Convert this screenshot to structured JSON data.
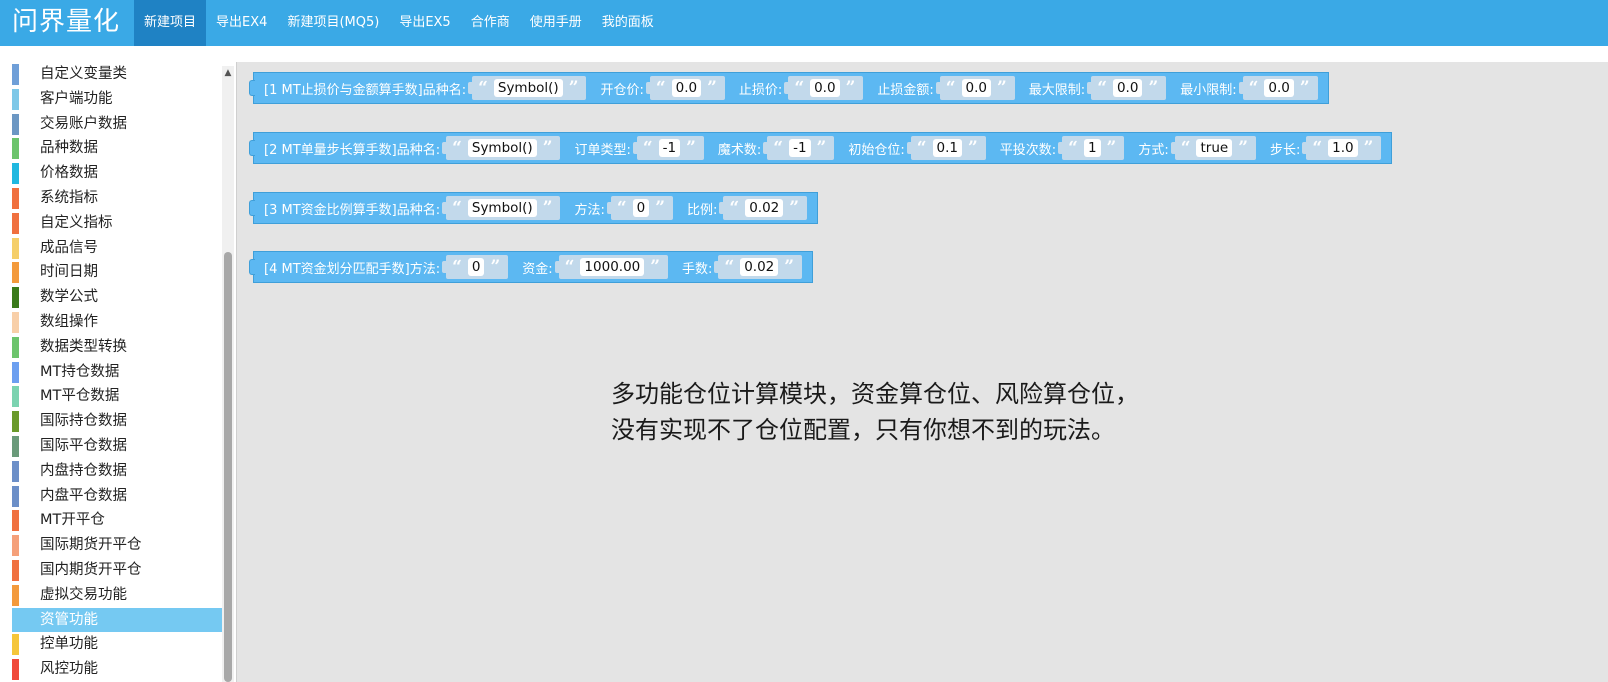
{
  "header": {
    "logo": "问界量化",
    "nav": [
      "新建项目",
      "导出EX4",
      "新建项目(MQ5)",
      "导出EX5",
      "合作商",
      "使用手册",
      "我的面板"
    ],
    "active_nav": "新建项目",
    "accent": "#3aa9e6",
    "active_bg": "#1f82c4"
  },
  "sidebar": {
    "items": [
      {
        "label": "自定义变量类",
        "color": "#6f9fd8"
      },
      {
        "label": "客户端功能",
        "color": "#7ec8e8"
      },
      {
        "label": "交易账户数据",
        "color": "#6c97c3"
      },
      {
        "label": "品种数据",
        "color": "#6cc46c"
      },
      {
        "label": "价格数据",
        "color": "#20b8e0"
      },
      {
        "label": "系统指标",
        "color": "#f0703f"
      },
      {
        "label": "自定义指标",
        "color": "#f0703f"
      },
      {
        "label": "成品信号",
        "color": "#f5cf6a"
      },
      {
        "label": "时间日期",
        "color": "#f39a3c"
      },
      {
        "label": "数学公式",
        "color": "#3a7a1a"
      },
      {
        "label": "数组操作",
        "color": "#f8cfa8"
      },
      {
        "label": "数据类型转换",
        "color": "#6cc46c"
      },
      {
        "label": "MT持仓数据",
        "color": "#6c9ff0"
      },
      {
        "label": "MT平仓数据",
        "color": "#7bd3b0"
      },
      {
        "label": "国际持仓数据",
        "color": "#6a9a2a"
      },
      {
        "label": "国际平仓数据",
        "color": "#6a9a7a"
      },
      {
        "label": "内盘持仓数据",
        "color": "#6c8fc8"
      },
      {
        "label": "内盘平仓数据",
        "color": "#6c8fc8"
      },
      {
        "label": "MT开平仓",
        "color": "#f0703f"
      },
      {
        "label": "国际期货开平仓",
        "color": "#f5a07a"
      },
      {
        "label": "国内期货开平仓",
        "color": "#f0703f"
      },
      {
        "label": "虚拟交易功能",
        "color": "#f39a3c"
      },
      {
        "label": "资管功能",
        "color": "#75c9f2",
        "selected": true
      },
      {
        "label": "控单功能",
        "color": "#f5c63a"
      },
      {
        "label": "风控功能",
        "color": "#f04a3a"
      }
    ]
  },
  "blocks": [
    {
      "title": "[1 MT止损价与金额算手数]品种名:",
      "params": [
        {
          "label": "",
          "value": "Symbol()"
        },
        {
          "label": "开仓价:",
          "value": "0.0"
        },
        {
          "label": "止损价:",
          "value": "0.0"
        },
        {
          "label": "止损金额:",
          "value": "0.0"
        },
        {
          "label": "最大限制:",
          "value": "0.0"
        },
        {
          "label": "最小限制:",
          "value": "0.0"
        }
      ]
    },
    {
      "title": "[2 MT单量步长算手数]品种名:",
      "params": [
        {
          "label": "",
          "value": "Symbol()"
        },
        {
          "label": "订单类型:",
          "value": "-1"
        },
        {
          "label": "魔术数:",
          "value": "-1"
        },
        {
          "label": "初始仓位:",
          "value": "0.1"
        },
        {
          "label": "平投次数:",
          "value": "1"
        },
        {
          "label": "方式:",
          "value": "true"
        },
        {
          "label": "步长:",
          "value": "1.0"
        }
      ]
    },
    {
      "title": "[3 MT资金比例算手数]品种名:",
      "params": [
        {
          "label": "",
          "value": "Symbol()"
        },
        {
          "label": "方法:",
          "value": "0"
        },
        {
          "label": "比例:",
          "value": "0.02"
        }
      ]
    },
    {
      "title": "[4 MT资金划分匹配手数]方法:",
      "params": [
        {
          "label": "",
          "value": "0"
        },
        {
          "label": "资金:",
          "value": "1000.00"
        },
        {
          "label": "手数:",
          "value": "0.02"
        }
      ]
    }
  ],
  "caption": {
    "line1": "多功能仓位计算模块，资金算仓位、风险算仓位，",
    "line2": "没有实现不了仓位配置，只有你想不到的玩法。"
  },
  "quote_open": "“",
  "quote_close": "”"
}
